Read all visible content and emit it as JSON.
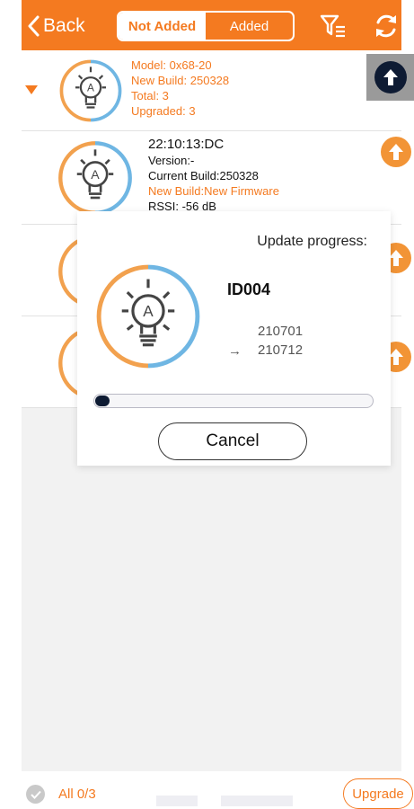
{
  "topbar": {
    "back_label": "Back",
    "tabs": [
      {
        "label": "Not Added",
        "active": true
      },
      {
        "label": "Added",
        "active": false
      }
    ]
  },
  "devices": [
    {
      "model": "Model: 0x68-20",
      "new_build": "New Build: 250328",
      "total": "Total: 3",
      "upgraded": "Upgraded: 3"
    },
    {
      "name": "22:10:13:DC",
      "version": "Version:-",
      "current_build": "Current Build:250328",
      "new_build": "New Build:New Firmware",
      "partial_line": "RSSI: -56 dB"
    }
  ],
  "dialog": {
    "title": "Update progress:",
    "device_id": "ID004",
    "from_version": "210701",
    "arrow": "→",
    "to_version": "210712",
    "progress_fraction": 0.03,
    "cancel_label": "Cancel"
  },
  "bottom": {
    "all_label": "All 0/3",
    "upgrade_label": "Upgrade"
  },
  "colors": {
    "accent": "#f47a20",
    "dark_navy": "#0e1b33",
    "upload_orange": "#f29436"
  }
}
